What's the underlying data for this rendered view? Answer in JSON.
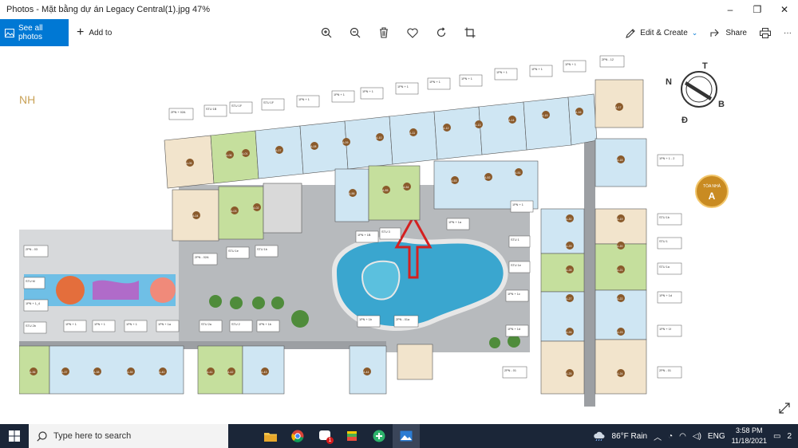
{
  "window": {
    "title": "Photos - Mặt bằng dự án Legacy Central(1).jpg   47%",
    "controls": {
      "minimize": "–",
      "maximize": "❐",
      "close": "✕"
    }
  },
  "toolbar": {
    "see_all": "See all photos",
    "add_to": "Add to",
    "edit_create": "Edit & Create",
    "share": "Share",
    "more": "···"
  },
  "image": {
    "corner_text": "NH",
    "compass": {
      "n": "N",
      "t": "T",
      "b": "B",
      "d": "Đ"
    },
    "tower_badge_line1": "TÒA NHÀ",
    "tower_badge_line2": "A",
    "units_row": [
      "A-06",
      "A-07",
      "A-08",
      "A-09",
      "A-10",
      "A-11",
      "A-12",
      "A-13",
      "A-14",
      "A-15",
      "A-16",
      "A-17"
    ],
    "inner_units": [
      "A-05",
      "A-04",
      "A-03",
      "A-02",
      "A-01",
      "A-56",
      "A-55",
      "A-54",
      "A-53",
      "A-52",
      "A-51"
    ],
    "right_units": [
      "A-18",
      "A-19",
      "A-20",
      "A-21",
      "A-22",
      "A-23",
      "A-24",
      "A-25",
      "A-26",
      "A-27",
      "A-28",
      "A-29",
      "A-30"
    ],
    "bottom_units": [
      "A-36",
      "A-37",
      "A-38",
      "A-39",
      "A-40",
      "A-41",
      "A-42",
      "A-43",
      "A-44"
    ],
    "labels": {
      "l1": "2PN + 02A",
      "l2": "STU 1B",
      "l3": "STU 1F",
      "l4": "STU 1F",
      "l5": "1PN + 1",
      "l6": "1PN + 1",
      "l7": "1PN + 1",
      "l8": "1PN + 1",
      "l9": "1PN + 1",
      "l10": "1PN + 1",
      "l11": "1PN + 1",
      "l12": "1PN + 1",
      "l13": "1PN + 1",
      "l14": "2PN - 12",
      "r1": "1PN + 1 - 2",
      "r2": "STU 1b",
      "r3": "STU 1",
      "r4": "STU 1a",
      "r5": "1PN + 1d",
      "r6": "1PN + 1f",
      "r7": "2PN - 01",
      "r8": "2PN - 01",
      "b1": "STU 2b",
      "b2": "1PN + 1",
      "b3": "1PN + 1",
      "b4": "1PN + 1",
      "b5": "1PN + 1a",
      "b6": "STU 2a",
      "b7": "STU 2",
      "b8": "1PN + 1b",
      "b9": "2PN - 03",
      "b10": "STU M",
      "b11": "1PN + 1_4",
      "c1": "2PN - 02A",
      "c2": "STU 1e",
      "c3": "STU 1b",
      "p1": "1PN + 1B",
      "p2": "STU 3",
      "p3": "1PN + 1a",
      "p4": "1PN + 1",
      "p5": "STU 1",
      "p6": "STU 1e",
      "p7": "1PN + 1c",
      "p8": "1PN + 1d",
      "p9": "1PN + 1b",
      "p10": "2PN - 01a"
    }
  },
  "taskbar": {
    "search_placeholder": "Type here to search",
    "weather": "86°F  Rain",
    "lang": "ENG",
    "time": "3:58 PM",
    "date": "11/18/2021",
    "notification_badge": "1",
    "notification_count": "2"
  },
  "colors": {
    "accent": "#0078d4",
    "taskbar": "#1b2638",
    "unit_blue": "#cfe6f3",
    "unit_green": "#c5df9d",
    "unit_beige": "#f2e4cc",
    "paving": "#b7babd",
    "water": "#3aa6cf",
    "arrow": "#d42020"
  }
}
